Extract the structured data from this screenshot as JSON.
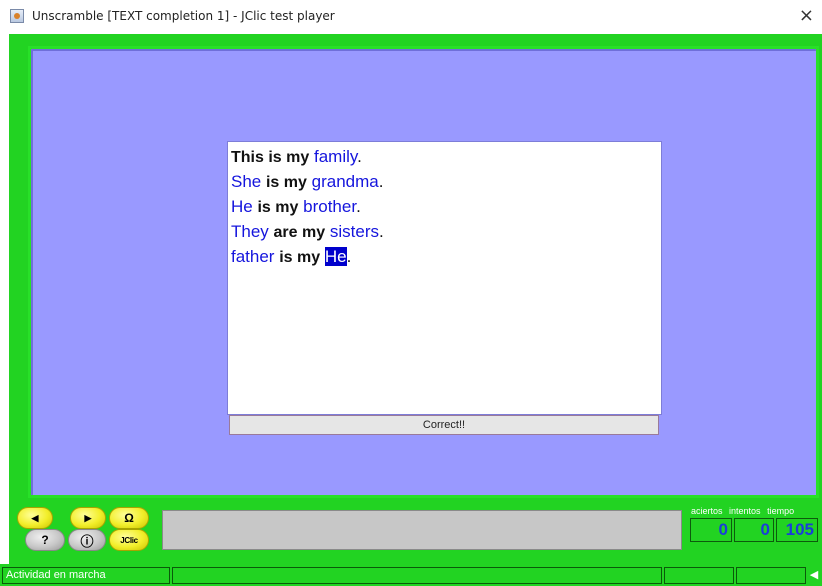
{
  "window": {
    "title": "Unscramble [TEXT completion 1] - JClic test player",
    "close_glyph": "×"
  },
  "activity": {
    "lines": [
      [
        {
          "t": "This is my",
          "kind": "fixed"
        },
        {
          "t": " "
        },
        {
          "t": "family",
          "kind": "word"
        },
        {
          "t": "."
        }
      ],
      [
        {
          "t": "She",
          "kind": "word"
        },
        {
          "t": " "
        },
        {
          "t": "is my",
          "kind": "fixed"
        },
        {
          "t": " "
        },
        {
          "t": "grandma",
          "kind": "word"
        },
        {
          "t": "."
        }
      ],
      [
        {
          "t": "He",
          "kind": "word"
        },
        {
          "t": " "
        },
        {
          "t": "is my",
          "kind": "fixed"
        },
        {
          "t": " "
        },
        {
          "t": "brother",
          "kind": "word"
        },
        {
          "t": "."
        }
      ],
      [
        {
          "t": "They",
          "kind": "word"
        },
        {
          "t": " "
        },
        {
          "t": "are my",
          "kind": "fixed"
        },
        {
          "t": " "
        },
        {
          "t": "sisters",
          "kind": "word"
        },
        {
          "t": "."
        }
      ],
      [
        {
          "t": "father",
          "kind": "word"
        },
        {
          "t": " "
        },
        {
          "t": "is my",
          "kind": "fixed"
        },
        {
          "t": " "
        },
        {
          "t": "He",
          "kind": "word",
          "selected": true
        },
        {
          "t": "."
        }
      ]
    ],
    "check_label": "Correct!!"
  },
  "controls": {
    "prev_glyph": "◀",
    "next_glyph": "▶",
    "restart_glyph": "Ω",
    "help_glyph": "?",
    "info_glyph": "ⓘ",
    "jclic_label": "JClic"
  },
  "counters": {
    "labels": [
      "aciertos",
      "intentos",
      "tiempo"
    ],
    "aciertos": "0",
    "intentos": "0",
    "tiempo": "105"
  },
  "status": {
    "text": "Actividad en marcha"
  }
}
